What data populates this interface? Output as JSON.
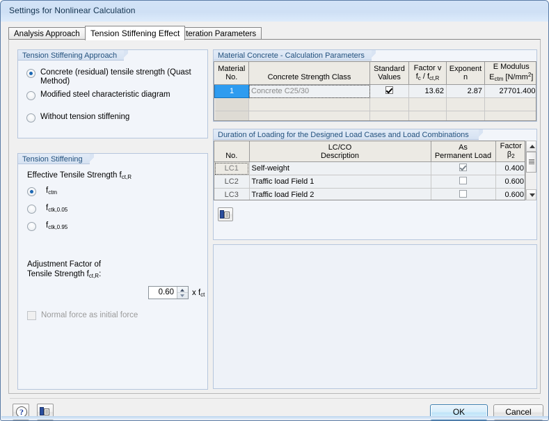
{
  "window": {
    "title": "Settings for Nonlinear Calculation"
  },
  "tabs": [
    {
      "label": "Analysis Approach",
      "active": false
    },
    {
      "label": "Tension Stiffening Effect",
      "active": true
    },
    {
      "label": "Iteration Parameters",
      "active": false
    }
  ],
  "approach_group": {
    "title": "Tension Stiffening Approach",
    "options": [
      {
        "label": "Concrete (residual) tensile strength (Quast Method)",
        "selected": true
      },
      {
        "label": "Modified steel characteristic diagram",
        "selected": false
      },
      {
        "label": "Without tension stiffening",
        "selected": false
      }
    ]
  },
  "stiffening_group": {
    "title": "Tension Stiffening",
    "effective_label_main": "Effective Tensile Strength f",
    "effective_label_sub": "ct,R",
    "options": [
      {
        "main": "f",
        "sub": "ctm",
        "selected": true
      },
      {
        "main": "f",
        "sub": "ctk,0.05",
        "selected": false
      },
      {
        "main": "f",
        "sub": "ctk,0.95",
        "selected": false
      }
    ],
    "adjustment_line1": "Adjustment Factor of",
    "adjustment_line2": "Tensile Strength  f",
    "adjustment_line2_sub": "ct,R",
    "adjustment_line2_end": ":",
    "adjustment_value": "0.60",
    "adjustment_unit_main": "x f",
    "adjustment_unit_sub": "ct",
    "normal_force_checkbox": {
      "label": "Normal force as initial force",
      "checked": false,
      "disabled": true
    }
  },
  "material_table": {
    "title": "Material Concrete - Calculation Parameters",
    "headers": [
      {
        "line1": "Material",
        "line2": "No."
      },
      {
        "line1": "",
        "line2": "Concrete Strength Class"
      },
      {
        "line1": "Standard",
        "line2": "Values"
      },
      {
        "line1": "Factor v",
        "line2": "f c / f ct,R"
      },
      {
        "line1": "Exponent",
        "line2": "n"
      },
      {
        "line1": "E Modulus",
        "line2": "E ctm [N/mm 2]"
      }
    ],
    "rows": [
      {
        "no": "1",
        "strength_class": "Concrete C25/30",
        "standard_values": true,
        "factor_v": "13.62",
        "exponent_n": "2.87",
        "e_modulus": "27701.400"
      }
    ]
  },
  "duration_table": {
    "title": "Duration of Loading for the Designed Load Cases and Load Combinations",
    "headers": [
      {
        "line1": "",
        "line2": "No."
      },
      {
        "line1": "LC/CO",
        "line2": "Description"
      },
      {
        "line1": "As",
        "line2": "Permanent Load"
      },
      {
        "line1": "Factor",
        "line2": "β2"
      }
    ],
    "rows": [
      {
        "no": "LC1",
        "description": "Self-weight",
        "permanent": true,
        "factor": "0.400",
        "focused": true
      },
      {
        "no": "LC2",
        "description": "Traffic load Field 1",
        "permanent": false,
        "factor": "0.600",
        "focused": false
      },
      {
        "no": "LC3",
        "description": "Traffic load Field 2",
        "permanent": false,
        "factor": "0.600",
        "focused": false
      }
    ]
  },
  "toolbar": {
    "grid_settings_icon": "table-settings-icon"
  },
  "footer": {
    "help_icon": "help-question-icon",
    "details_icon": "table-settings-icon",
    "ok_label": "OK",
    "cancel_label": "Cancel"
  },
  "colors": {
    "accent": "#2e9cf0",
    "group_title": "#24527e",
    "title_text": "#12324e",
    "default_button_border": "#3c7fb1"
  }
}
